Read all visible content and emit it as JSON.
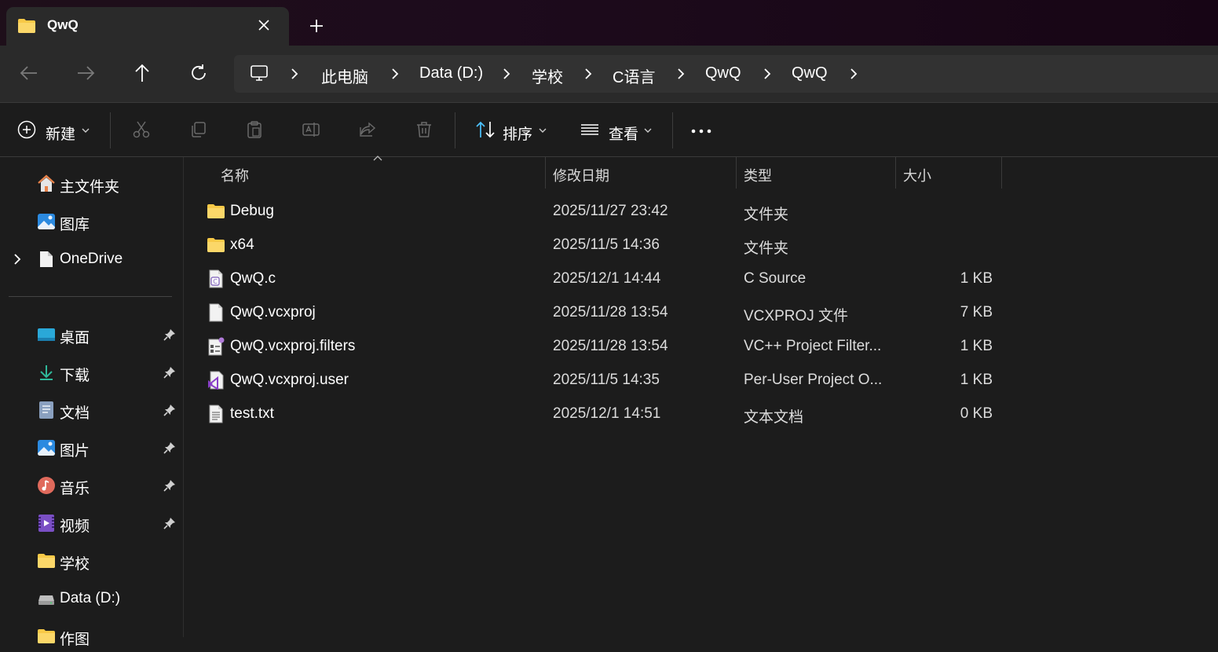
{
  "window": {
    "tab_title": "QwQ"
  },
  "breadcrumb": [
    "此电脑",
    "Data (D:)",
    "学校",
    "C语言",
    "QwQ",
    "QwQ"
  ],
  "toolbar": {
    "new_label": "新建",
    "sort_label": "排序",
    "view_label": "查看"
  },
  "sidebar": {
    "top_items": [
      {
        "label": "主文件夹",
        "icon": "home-icon"
      },
      {
        "label": "图库",
        "icon": "gallery-icon"
      },
      {
        "label": "OneDrive",
        "icon": "onedrive-icon",
        "expandable": true
      }
    ],
    "pinned_items": [
      {
        "label": "桌面",
        "icon": "desktop-icon",
        "pinned": true
      },
      {
        "label": "下载",
        "icon": "download-icon",
        "pinned": true
      },
      {
        "label": "文档",
        "icon": "documents-icon",
        "pinned": true
      },
      {
        "label": "图片",
        "icon": "pictures-icon",
        "pinned": true
      },
      {
        "label": "音乐",
        "icon": "music-icon",
        "pinned": true
      },
      {
        "label": "视频",
        "icon": "videos-icon",
        "pinned": true
      },
      {
        "label": "学校",
        "icon": "folder-icon",
        "pinned": false
      },
      {
        "label": "Data (D:)",
        "icon": "drive-icon",
        "pinned": false
      },
      {
        "label": "作图",
        "icon": "folder-icon",
        "pinned": false
      }
    ]
  },
  "columns": {
    "name": "名称",
    "modified": "修改日期",
    "type": "类型",
    "size": "大小"
  },
  "files": [
    {
      "name": "Debug",
      "modified": "2025/11/27 23:42",
      "type": "文件夹",
      "size": "",
      "icon": "folder-icon"
    },
    {
      "name": "x64",
      "modified": "2025/11/5 14:36",
      "type": "文件夹",
      "size": "",
      "icon": "folder-icon"
    },
    {
      "name": "QwQ.c",
      "modified": "2025/12/1 14:44",
      "type": "C Source",
      "size": "1 KB",
      "icon": "c-source-file-icon"
    },
    {
      "name": "QwQ.vcxproj",
      "modified": "2025/11/28 13:54",
      "type": "VCXPROJ 文件",
      "size": "7 KB",
      "icon": "blank-file-icon"
    },
    {
      "name": "QwQ.vcxproj.filters",
      "modified": "2025/11/28 13:54",
      "type": "VC++ Project Filter...",
      "size": "1 KB",
      "icon": "filters-file-icon"
    },
    {
      "name": "QwQ.vcxproj.user",
      "modified": "2025/11/5 14:35",
      "type": "Per-User Project O...",
      "size": "1 KB",
      "icon": "visual-studio-file-icon"
    },
    {
      "name": "test.txt",
      "modified": "2025/12/1 14:51",
      "type": "文本文档",
      "size": "0 KB",
      "icon": "text-file-icon"
    }
  ],
  "colors": {
    "folder": "#f8c947",
    "accent": "#4cc2ff"
  }
}
